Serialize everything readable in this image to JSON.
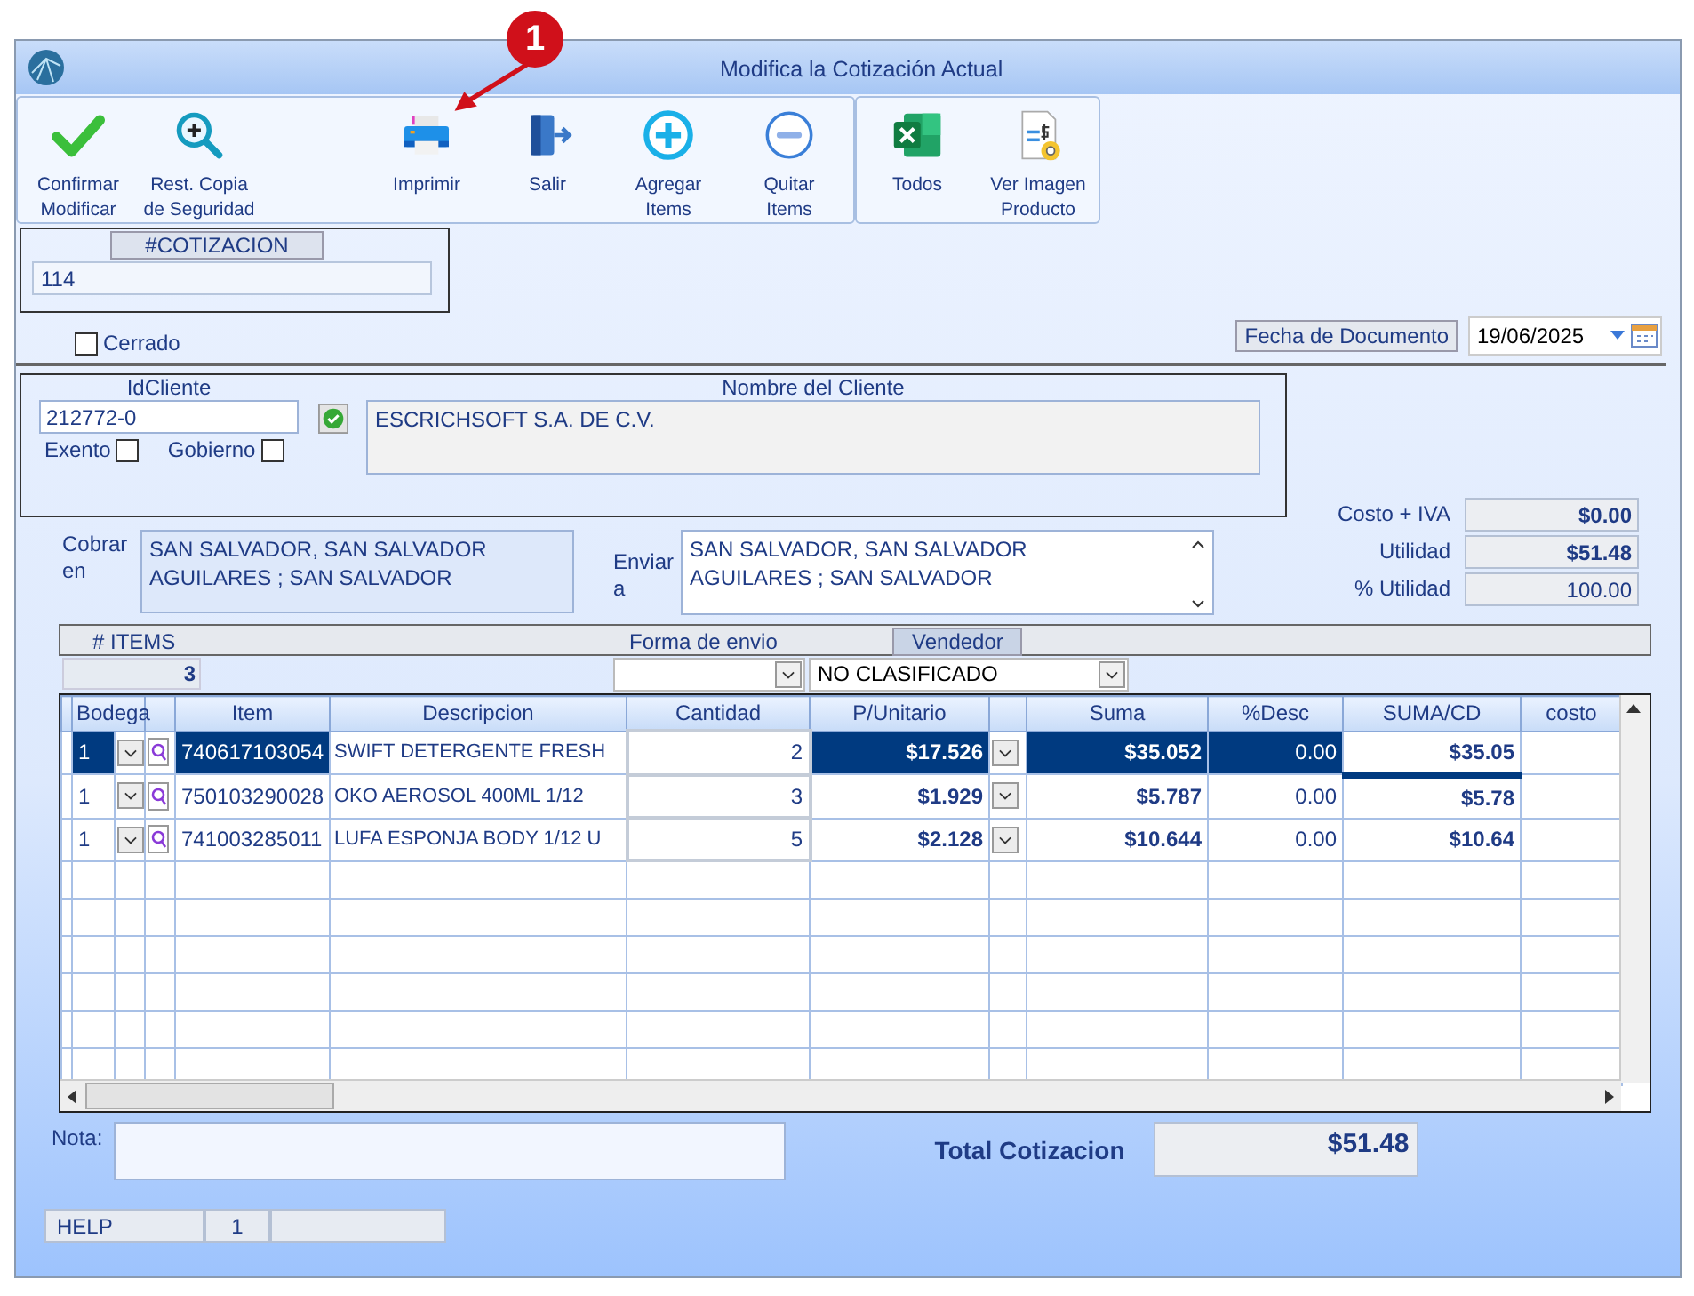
{
  "window": {
    "title": "Modifica la Cotización Actual"
  },
  "annotation": {
    "number": "1"
  },
  "toolbar": [
    {
      "buttons": [
        {
          "kind": "check",
          "label": "Confirmar\nModificar"
        },
        {
          "kind": "restore",
          "label": "Rest. Copia\nde Seguridad"
        },
        {
          "kind": "spacer"
        },
        {
          "kind": "print",
          "label": "Imprimir"
        },
        {
          "kind": "exit",
          "label": "Salir"
        },
        {
          "kind": "add",
          "label": "Agregar\nItems"
        },
        {
          "kind": "remove",
          "label": "Quitar\nItems"
        }
      ]
    },
    {
      "buttons": [
        {
          "kind": "excel",
          "label": "Todos"
        },
        {
          "kind": "invoice",
          "label": "Ver Imagen\nProducto"
        }
      ]
    }
  ],
  "cotizacion": {
    "label": "#COTIZACION",
    "value": "114"
  },
  "cerrado": {
    "label": "Cerrado",
    "checked": false
  },
  "fecha": {
    "label": "Fecha de  Documento",
    "value": "19/06/2025"
  },
  "cliente": {
    "id_label": "IdCliente",
    "id": "212772-0",
    "name_label": "Nombre del Cliente",
    "name": "ESCRICHSOFT S.A. DE C.V.",
    "exento": {
      "label": "Exento",
      "checked": false
    },
    "gobierno": {
      "label": "Gobierno",
      "checked": false
    }
  },
  "cobrar": {
    "label": "Cobrar\nen",
    "value": "SAN SALVADOR, SAN SALVADOR\nAGUILARES ; SAN SALVADOR"
  },
  "enviar": {
    "label": "Enviar\na",
    "value": "SAN SALVADOR, SAN SALVADOR\nAGUILARES ; SAN SALVADOR"
  },
  "totals": [
    {
      "label": "Costo + IVA",
      "value": "$0.00",
      "bold": true
    },
    {
      "label": "Utilidad",
      "value": "$51.48",
      "bold": true
    },
    {
      "label": "% Utilidad",
      "value": "100.00",
      "bold": false
    }
  ],
  "items_bar": {
    "items_label": "# ITEMS",
    "items_count": "3",
    "forma_label": "Forma de envio",
    "vendedor_label": "Vendedor",
    "vendedor": "NO CLASIFICADO"
  },
  "table": {
    "columns": [
      "Bodega",
      "Item",
      "Descripcion",
      "Cantidad",
      "P/Unitario",
      "Suma",
      "%Desc",
      "SUMA/CD",
      "costo"
    ],
    "rows": [
      {
        "selected": true,
        "bodega": "1",
        "item": "740617103054",
        "descripcion": "SWIFT DETERGENTE FRESH",
        "cantidad": "2",
        "unitario": "$17.526",
        "suma": "$35.052",
        "desc": "0.00",
        "sumacd": "$35.05"
      },
      {
        "selected": false,
        "bodega": "1",
        "item": "750103290028",
        "descripcion": "OKO AEROSOL  400ML 1/12",
        "cantidad": "3",
        "unitario": "$1.929",
        "suma": "$5.787",
        "desc": "0.00",
        "sumacd": "$5.78"
      },
      {
        "selected": false,
        "bodega": "1",
        "item": "741003285011",
        "descripcion": "LUFA ESPONJA BODY 1/12 U",
        "cantidad": "5",
        "unitario": "$2.128",
        "suma": "$10.644",
        "desc": "0.00",
        "sumacd": "$10.64"
      }
    ]
  },
  "nota": {
    "label": "Nota:"
  },
  "total": {
    "label": "Total Cotizacion",
    "value": "$51.48"
  },
  "status_bar": [
    "HELP",
    "1"
  ]
}
